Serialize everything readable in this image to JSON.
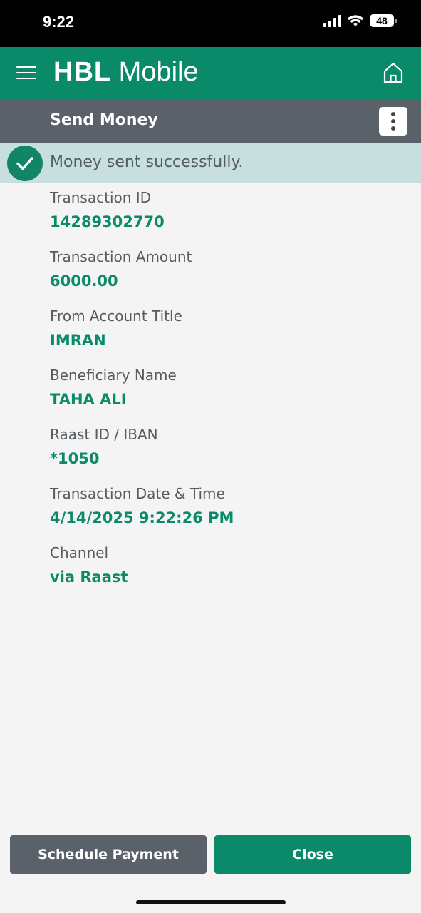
{
  "status_bar": {
    "time": "9:22",
    "battery": "48"
  },
  "app_bar": {
    "brand_bold": "HBL",
    "brand_rest": " Mobile"
  },
  "page": {
    "title": "Send Money"
  },
  "banner": {
    "message": "Money sent successfully."
  },
  "details": [
    {
      "label": "Transaction ID",
      "value": "14289302770"
    },
    {
      "label": "Transaction Amount",
      "value": "6000.00"
    },
    {
      "label": "From Account Title",
      "value": "IMRAN"
    },
    {
      "label": "Beneficiary Name",
      "value": "TAHA ALI"
    },
    {
      "label": "Raast ID / IBAN",
      "value": "*1050"
    },
    {
      "label": "Transaction Date & Time",
      "value": "4/14/2025 9:22:26 PM"
    },
    {
      "label": "Channel",
      "value": "via Raast"
    }
  ],
  "actions": {
    "schedule_label": "Schedule Payment",
    "close_label": "Close"
  },
  "colors": {
    "brand_green": "#0b8a6a",
    "header_gray": "#5a6169",
    "banner_bg": "#c7e0dd"
  },
  "icons": [
    "signal-icon",
    "wifi-icon",
    "battery-icon",
    "menu-icon",
    "home-icon",
    "more-vertical-icon",
    "check-circle-icon"
  ]
}
